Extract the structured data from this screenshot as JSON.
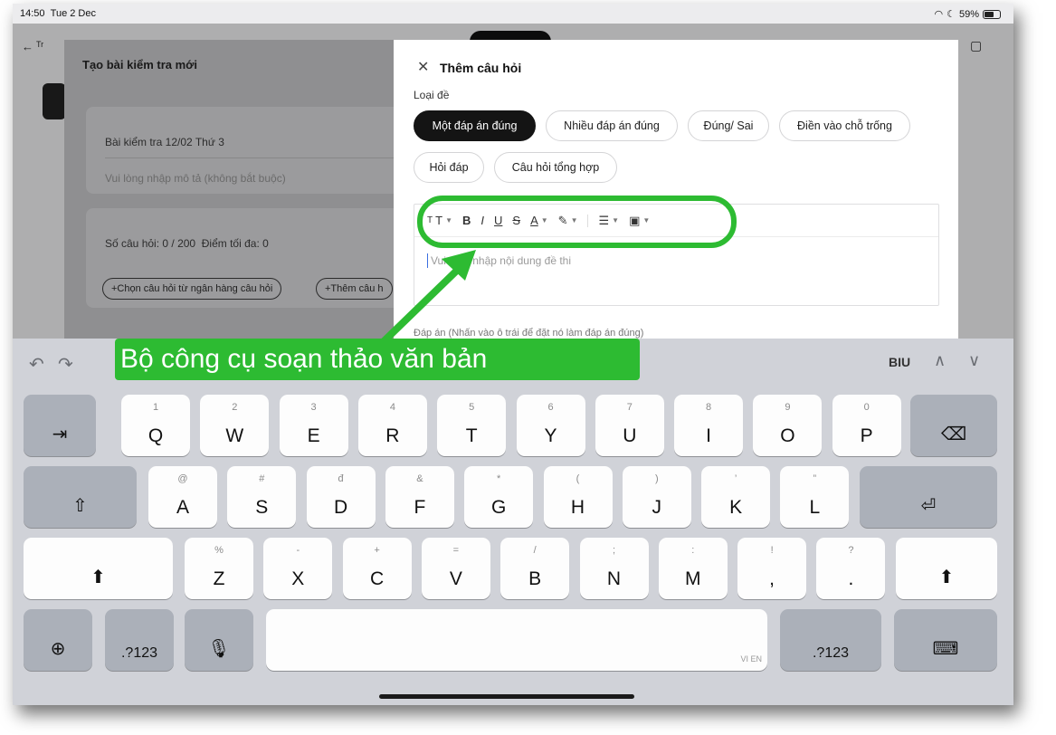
{
  "status_bar": {
    "time": "14:50",
    "date": "Tue 2 Dec",
    "battery": "59%"
  },
  "background": {
    "back_label": "Tr",
    "panel_title": "Tạo bài kiểm tra mới",
    "test_name": "Bài kiểm tra 12/02 Thứ 3",
    "description_placeholder": "Vui lòng nhập mô tả (không bắt buộc)",
    "question_count_label": "Số câu hỏi:",
    "question_count": "0 / 200",
    "max_score_label": "Điểm tối đa:",
    "max_score": "0",
    "bank_button": "+Chọn câu hỏi từ ngân hàng câu hỏi",
    "add_button": "+Thêm câu h"
  },
  "modal": {
    "title": "Thêm câu hỏi",
    "type_label": "Loại đề",
    "types": [
      "Một đáp án đúng",
      "Nhiều đáp án đúng",
      "Đúng/ Sai",
      "Điền vào chỗ trống",
      "Hỏi đáp",
      "Câu hỏi tổng hợp"
    ],
    "active_type": "Một đáp án đúng",
    "editor_placeholder": "Vui lòng nhập nội dung đề thi",
    "answer_hint": "Đáp án (Nhấn vào ô trái để đặt nó làm đáp án đúng)"
  },
  "toolbar": {
    "text_size": "TT",
    "bold": "B",
    "italic": "I",
    "underline": "U",
    "strike": "S",
    "font_color": "A"
  },
  "keyboard": {
    "row1": [
      [
        "1",
        "Q"
      ],
      [
        "2",
        "W"
      ],
      [
        "3",
        "E"
      ],
      [
        "4",
        "R"
      ],
      [
        "5",
        "T"
      ],
      [
        "6",
        "Y"
      ],
      [
        "7",
        "U"
      ],
      [
        "8",
        "I"
      ],
      [
        "9",
        "O"
      ],
      [
        "0",
        "P"
      ]
    ],
    "row2": [
      [
        "@",
        "A"
      ],
      [
        "#",
        "S"
      ],
      [
        "đ",
        "D"
      ],
      [
        "&",
        "F"
      ],
      [
        "*",
        "G"
      ],
      [
        "(",
        "H"
      ],
      [
        ")",
        "J"
      ],
      [
        "’",
        "K"
      ],
      [
        "”",
        "L"
      ]
    ],
    "row3": [
      [
        "%",
        "Z"
      ],
      [
        "-",
        "X"
      ],
      [
        "+",
        "C"
      ],
      [
        "=",
        "V"
      ],
      [
        "/",
        "B"
      ],
      [
        ";",
        "N"
      ],
      [
        ":",
        "M"
      ],
      [
        "!",
        ","
      ],
      [
        "?",
        "."
      ]
    ],
    "numbers_label": ".?123",
    "space_label": "VI EN",
    "format_label": "BIU"
  },
  "annotation": {
    "callout": "Bộ công cụ soạn thảo văn bản"
  },
  "colors": {
    "highlight": "#2dbb32",
    "active_chip": "#141414"
  }
}
